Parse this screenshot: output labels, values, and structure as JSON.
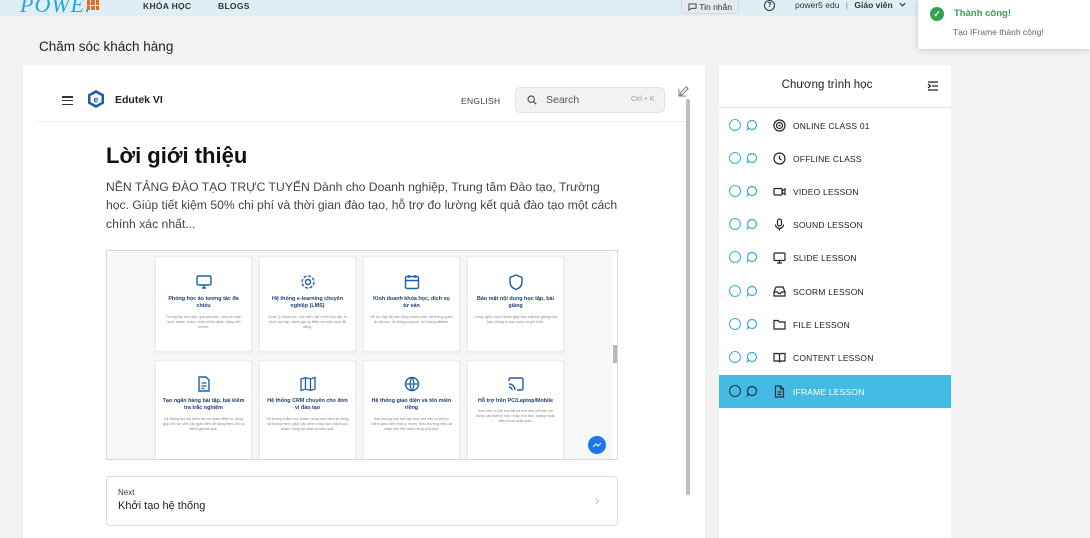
{
  "nav": {
    "logo_text": "POWEr",
    "links": [
      "KHÓA HỌC",
      "BLOGS"
    ],
    "messages_label": "Tin nhắn",
    "user_name": "power5 edu",
    "user_role": "Giáo viên"
  },
  "toast": {
    "title": "Thành công!",
    "message": "Tạo IFrame thành công!"
  },
  "page_title": "Chăm sóc khách hàng",
  "preview": {
    "site_name": "Edutek VI",
    "language": "ENGLISH",
    "search_placeholder": "Search",
    "search_shortcut": "Ctrl + K",
    "heading": "Lời giới thiệu",
    "intro": "NỀN TẢNG ĐÀO TẠO TRỰC TUYẾN Dành cho Doanh nghiệp, Trung tâm Đào tạo, Trường học. Giúp tiết kiệm 50% chi phí và thời gian đào tạo, hỗ trợ đo lường kết quả đào tạo một cách chính xác nhất...",
    "features": [
      {
        "icon": "monitor-icon",
        "title": "Phòng học ảo tương tác đa chiều",
        "desc": "Tương tác trực tiếp qua webcam, chia sẻ màn hình, audio, video, trình chiếu slide, bảng viết online."
      },
      {
        "icon": "gear-icon",
        "title": "Hệ thống e-learning chuyên nghiệp (LMS)",
        "desc": "Quản lý khóa học, học viên, tiến trình học tập, lộ trình học tập, đánh giá và kiểm tra một cách dễ dàng."
      },
      {
        "icon": "calendar-icon",
        "title": "Kinh doanh khóa học, dịch vụ tư vấn",
        "desc": "Hỗ trợ đầy đủ các cổng thanh toán, hệ thống quản lý mã học, hệ thống coupon, hệ thống affiliate."
      },
      {
        "icon": "shield-icon",
        "title": "Bảo mật nội dung học tập, bài giảng",
        "desc": "Công nghệ của Edutek giúp bảo mật bài giảng của bạn không bị sao chép và ghi hình."
      },
      {
        "icon": "document-icon",
        "title": "Tạo ngân hàng bài tập, bài kiểm tra trắc nghiệm",
        "desc": "Hệ thống tạo bài kiểm tra và chấm điểm tự động giúp cả học viên lẫn giáo viên dễ dàng theo dõi và đánh giá kết quả."
      },
      {
        "icon": "map-icon",
        "title": "Hệ thống CRM chuyên cho đơn vị đào tạo",
        "desc": "Hệ thống nhắm vào khách hàng mới cách tự động và thông minh, giúp các đơn vị đào tạo chăm sóc khách hàng tốt nhất và hiệu quả."
      },
      {
        "icon": "globe-icon",
        "title": "Hệ thống giao diện và tên miền riêng",
        "desc": "Bạn không cần biết lập trình mà vẫn có thể tự chỉnh giao diện theo ý muốn, theo thương hiệu và chạy trên tên miền riêng của bạn."
      },
      {
        "icon": "cast-icon",
        "title": "Hỗ trợ trên PC/Laptop/Mobile",
        "desc": "Học viên có thể học tất cả mọi đều với tiện ích trong các thiết bị như: máy tính bàn, laptop hoặc điện thoại hoặc ipad."
      }
    ],
    "next_label": "Next",
    "next_title": "Khởi tạo hệ thống"
  },
  "sidebar": {
    "title": "Chương trình học",
    "lessons": [
      {
        "label": "ONLINE CLASS 01",
        "icon": "target-icon"
      },
      {
        "label": "OFFLINE CLASS",
        "icon": "clock-icon"
      },
      {
        "label": "VIDEO LESSON",
        "icon": "video-icon"
      },
      {
        "label": "SOUND LESSON",
        "icon": "microphone-icon"
      },
      {
        "label": "SLIDE LESSON",
        "icon": "monitor-icon"
      },
      {
        "label": "SCORM LESSON",
        "icon": "inbox-icon"
      },
      {
        "label": "FILE LESSON",
        "icon": "folder-icon"
      },
      {
        "label": "CONTENT LESSON",
        "icon": "book-icon"
      },
      {
        "label": "IFRAME LESSON",
        "icon": "file-icon",
        "active": true
      }
    ]
  },
  "colors": {
    "accent": "#44bbe4",
    "success": "#2fa34f",
    "feature_icon": "#1d5fa8"
  }
}
